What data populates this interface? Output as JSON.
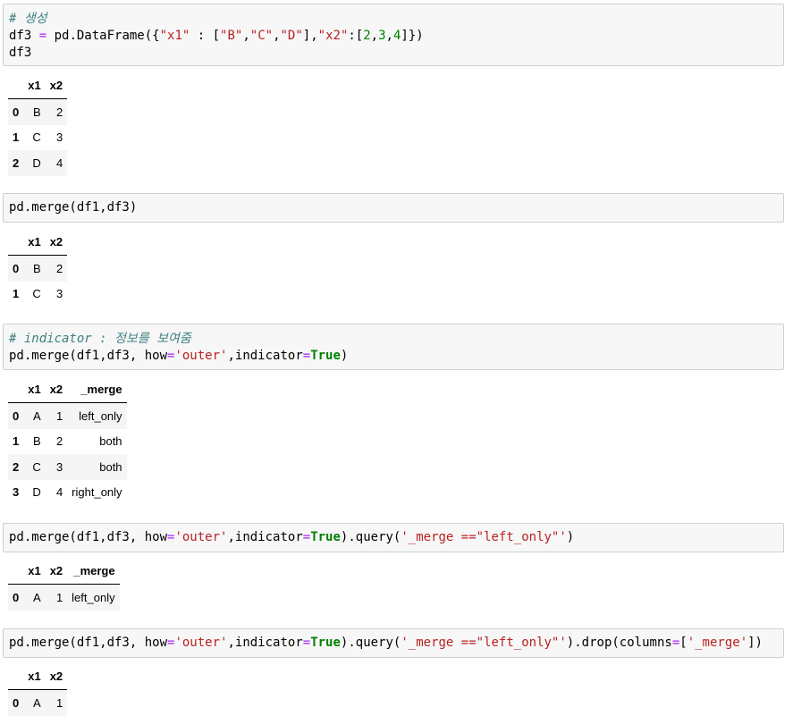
{
  "cells": [
    {
      "code_lines": [
        [
          {
            "t": "# 생성",
            "c": "cm"
          }
        ],
        [
          {
            "t": "df3 "
          },
          {
            "t": "=",
            "c": "op"
          },
          {
            "t": " pd.DataFrame({"
          },
          {
            "t": "\"x1\"",
            "c": "st"
          },
          {
            "t": " : ["
          },
          {
            "t": "\"B\"",
            "c": "st"
          },
          {
            "t": ","
          },
          {
            "t": "\"C\"",
            "c": "st"
          },
          {
            "t": ","
          },
          {
            "t": "\"D\"",
            "c": "st"
          },
          {
            "t": "],"
          },
          {
            "t": "\"x2\"",
            "c": "st"
          },
          {
            "t": ":["
          },
          {
            "t": "2",
            "c": "nu"
          },
          {
            "t": ","
          },
          {
            "t": "3",
            "c": "nu"
          },
          {
            "t": ","
          },
          {
            "t": "4",
            "c": "nu"
          },
          {
            "t": "]})"
          }
        ],
        [
          {
            "t": "df3"
          }
        ]
      ],
      "table": {
        "columns": [
          "",
          "x1",
          "x2"
        ],
        "rows": [
          [
            "0",
            "B",
            "2"
          ],
          [
            "1",
            "C",
            "3"
          ],
          [
            "2",
            "D",
            "4"
          ]
        ]
      }
    },
    {
      "code_lines": [
        [
          {
            "t": "pd.merge(df1,df3)"
          }
        ]
      ],
      "table": {
        "columns": [
          "",
          "x1",
          "x2"
        ],
        "rows": [
          [
            "0",
            "B",
            "2"
          ],
          [
            "1",
            "C",
            "3"
          ]
        ]
      }
    },
    {
      "code_lines": [
        [
          {
            "t": "# indicator : 정보를 보여줌",
            "c": "cm"
          }
        ],
        [
          {
            "t": "pd.merge(df1,df3, how"
          },
          {
            "t": "=",
            "c": "op"
          },
          {
            "t": "'outer'",
            "c": "st"
          },
          {
            "t": ",indicator"
          },
          {
            "t": "=",
            "c": "op"
          },
          {
            "t": "True",
            "c": "kw"
          },
          {
            "t": ")"
          }
        ]
      ],
      "table": {
        "columns": [
          "",
          "x1",
          "x2",
          "_merge"
        ],
        "rows": [
          [
            "0",
            "A",
            "1",
            "left_only"
          ],
          [
            "1",
            "B",
            "2",
            "both"
          ],
          [
            "2",
            "C",
            "3",
            "both"
          ],
          [
            "3",
            "D",
            "4",
            "right_only"
          ]
        ]
      }
    },
    {
      "code_lines": [
        [
          {
            "t": "pd.merge(df1,df3, how"
          },
          {
            "t": "=",
            "c": "op"
          },
          {
            "t": "'outer'",
            "c": "st"
          },
          {
            "t": ",indicator"
          },
          {
            "t": "=",
            "c": "op"
          },
          {
            "t": "True",
            "c": "kw"
          },
          {
            "t": ").query("
          },
          {
            "t": "'_merge ==\"left_only\"'",
            "c": "st"
          },
          {
            "t": ")"
          }
        ]
      ],
      "table": {
        "columns": [
          "",
          "x1",
          "x2",
          "_merge"
        ],
        "rows": [
          [
            "0",
            "A",
            "1",
            "left_only"
          ]
        ]
      }
    },
    {
      "code_lines": [
        [
          {
            "t": "pd.merge(df1,df3, how"
          },
          {
            "t": "=",
            "c": "op"
          },
          {
            "t": "'outer'",
            "c": "st"
          },
          {
            "t": ",indicator"
          },
          {
            "t": "=",
            "c": "op"
          },
          {
            "t": "True",
            "c": "kw"
          },
          {
            "t": ").query("
          },
          {
            "t": "'_merge ==\"left_only\"'",
            "c": "st"
          },
          {
            "t": ").drop(columns"
          },
          {
            "t": "=",
            "c": "op"
          },
          {
            "t": "["
          },
          {
            "t": "'_merge'",
            "c": "st"
          },
          {
            "t": "])"
          }
        ]
      ],
      "table": {
        "columns": [
          "",
          "x1",
          "x2"
        ],
        "rows": [
          [
            "0",
            "A",
            "1"
          ]
        ]
      }
    }
  ]
}
